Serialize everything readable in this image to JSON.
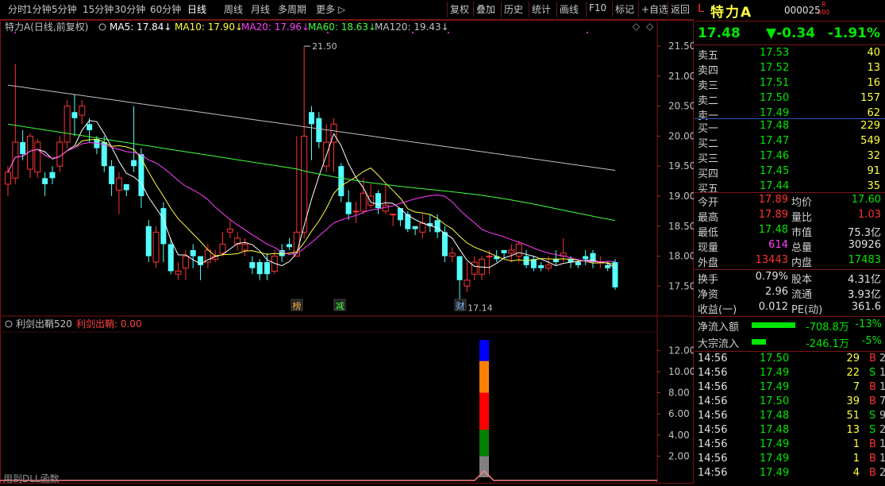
{
  "toolbar": {
    "left": [
      "分时",
      "1分钟",
      "5分钟",
      "15分钟",
      "30分钟",
      "60分钟",
      "日线",
      "周线",
      "月线",
      "多周期",
      "更多 ▷"
    ],
    "active_index": 6,
    "right": [
      "复权",
      "叠加",
      "历史",
      "统计",
      "画线",
      "F10",
      "标记",
      "+自选",
      "返回"
    ]
  },
  "chart_header": {
    "name": "特力A",
    "mode": "(日线,前复权)",
    "ma": [
      {
        "label": "MA5: 17.84↓",
        "color": "#ffffff"
      },
      {
        "label": "MA10: 17.90↓",
        "color": "#ffff40"
      },
      {
        "label": "MA20: 17.96↓",
        "color": "#ff40ff"
      },
      {
        "label": "MA60: 18.63↓",
        "color": "#40ff40"
      },
      {
        "label": "MA120: 19.43↓",
        "color": "#c0c0c0"
      }
    ]
  },
  "price_axis": [
    "21.50",
    "21.00",
    "20.50",
    "20.00",
    "19.50",
    "19.00",
    "18.50",
    "18.00",
    "17.50"
  ],
  "annotations": {
    "high": "21.50",
    "low": "17.14",
    "markers": [
      "榜",
      "减",
      "财"
    ]
  },
  "indicator": {
    "name": "利剑出鞘520",
    "value_label": "利剑出鞘: 0.00",
    "axis": [
      "12.00",
      "10.00",
      "8.00",
      "6.00",
      "4.00",
      "2.00"
    ],
    "footer": "用到DLL函数"
  },
  "chart_data": {
    "type": "candlestick",
    "ylim": [
      17.2,
      21.7
    ],
    "candles": [
      [
        19.2,
        19.4,
        19.0,
        19.5
      ],
      [
        19.3,
        19.9,
        19.2,
        21.2
      ],
      [
        19.9,
        19.7,
        19.6,
        20.1
      ],
      [
        19.45,
        20.0,
        19.3,
        20.05
      ],
      [
        19.4,
        19.9,
        19.3,
        19.95
      ],
      [
        19.3,
        19.2,
        19.0,
        19.4
      ],
      [
        19.4,
        19.3,
        19.2,
        19.5
      ],
      [
        19.5,
        19.9,
        19.4,
        20.0
      ],
      [
        19.9,
        20.5,
        19.8,
        20.6
      ],
      [
        20.4,
        20.3,
        20.0,
        20.7
      ],
      [
        20.35,
        20.5,
        20.2,
        20.6
      ],
      [
        20.2,
        20.1,
        19.9,
        20.3
      ],
      [
        19.95,
        19.8,
        19.7,
        20.0
      ],
      [
        19.9,
        19.5,
        19.4,
        20.0
      ],
      [
        19.5,
        19.2,
        19.0,
        19.6
      ],
      [
        19.1,
        19.3,
        18.7,
        19.4
      ],
      [
        19.2,
        19.1,
        19.0,
        19.2
      ],
      [
        19.6,
        19.5,
        19.4,
        20.5
      ],
      [
        19.7,
        19.0,
        18.8,
        19.8
      ],
      [
        18.5,
        18.0,
        17.9,
        18.6
      ],
      [
        17.9,
        18.4,
        17.8,
        18.5
      ],
      [
        18.8,
        18.2,
        17.9,
        18.9
      ],
      [
        18.2,
        17.75,
        17.7,
        18.3
      ],
      [
        17.7,
        17.75,
        17.6,
        17.9
      ],
      [
        17.8,
        18.0,
        17.6,
        18.1
      ],
      [
        18.1,
        18.0,
        17.8,
        18.2
      ],
      [
        18.0,
        17.85,
        17.6,
        17.95
      ],
      [
        17.9,
        18.1,
        17.8,
        18.2
      ],
      [
        17.95,
        18.0,
        17.9,
        18.1
      ],
      [
        18.05,
        18.2,
        18.0,
        18.4
      ],
      [
        18.4,
        18.45,
        18.3,
        18.6
      ],
      [
        18.2,
        18.3,
        18.1,
        18.4
      ],
      [
        18.1,
        18.2,
        18.0,
        18.3
      ],
      [
        17.9,
        17.8,
        17.7,
        18.0
      ],
      [
        17.9,
        17.7,
        17.6,
        17.95
      ],
      [
        17.9,
        17.7,
        17.6,
        18.05
      ],
      [
        17.75,
        18.0,
        17.7,
        18.1
      ],
      [
        18.1,
        18.0,
        17.9,
        18.2
      ],
      [
        18.2,
        18.15,
        18.1,
        18.3
      ],
      [
        18.0,
        18.4,
        18.0,
        20.0
      ],
      [
        18.4,
        20.0,
        18.3,
        21.5
      ],
      [
        20.4,
        20.2,
        19.6,
        20.5
      ],
      [
        20.3,
        19.9,
        19.8,
        20.4
      ],
      [
        19.5,
        19.9,
        19.4,
        20.2
      ],
      [
        19.9,
        20.2,
        19.4,
        20.3
      ],
      [
        19.5,
        19.0,
        18.9,
        19.55
      ],
      [
        18.9,
        18.7,
        18.6,
        19.1
      ],
      [
        18.75,
        18.75,
        18.55,
        18.9
      ],
      [
        18.75,
        19.05,
        18.7,
        19.3
      ],
      [
        18.85,
        19.0,
        18.8,
        19.2
      ],
      [
        19.05,
        18.8,
        18.7,
        19.1
      ],
      [
        18.75,
        18.85,
        18.7,
        19.2
      ],
      [
        18.7,
        18.7,
        18.5,
        18.7
      ],
      [
        18.8,
        18.6,
        18.5,
        18.8
      ],
      [
        18.7,
        18.45,
        18.4,
        18.75
      ],
      [
        18.5,
        18.45,
        18.35,
        18.5
      ],
      [
        18.4,
        18.55,
        18.3,
        18.7
      ],
      [
        18.55,
        18.5,
        18.4,
        18.7
      ],
      [
        18.6,
        18.4,
        18.3,
        18.7
      ],
      [
        18.4,
        18.0,
        17.9,
        18.5
      ],
      [
        18.0,
        18.05,
        17.9,
        18.15
      ],
      [
        18.0,
        17.6,
        17.14,
        18.0
      ],
      [
        17.5,
        17.6,
        17.4,
        17.9
      ],
      [
        17.7,
        17.9,
        17.6,
        18.0
      ],
      [
        17.7,
        17.95,
        17.6,
        18.0
      ],
      [
        18.0,
        18.0,
        17.7,
        18.1
      ],
      [
        18.0,
        17.95,
        17.9,
        18.1
      ],
      [
        18.1,
        18.05,
        17.95,
        18.1
      ],
      [
        18.05,
        18.1,
        17.9,
        18.2
      ],
      [
        18.0,
        18.2,
        17.9,
        18.25
      ],
      [
        18.0,
        17.85,
        17.8,
        18.1
      ],
      [
        17.95,
        17.8,
        17.75,
        18.0
      ],
      [
        17.85,
        17.8,
        17.75,
        17.9
      ],
      [
        17.8,
        17.85,
        17.75,
        18.0
      ],
      [
        17.95,
        17.9,
        17.85,
        18.1
      ],
      [
        18.0,
        18.05,
        17.9,
        18.3
      ],
      [
        17.95,
        17.9,
        17.8,
        18.0
      ],
      [
        17.9,
        17.85,
        17.8,
        17.95
      ],
      [
        18.0,
        17.95,
        17.85,
        18.1
      ],
      [
        18.05,
        17.9,
        17.8,
        18.1
      ],
      [
        17.9,
        17.9,
        17.8,
        18.0
      ],
      [
        17.85,
        17.8,
        17.75,
        17.9
      ],
      [
        17.9,
        17.48,
        17.44,
        17.95
      ]
    ]
  },
  "quote": {
    "prefix": "L",
    "name": "特力A",
    "code": "000025",
    "code_badge_top": "R",
    "code_badge_bottom": "500",
    "price": "17.48",
    "change": "▼-0.34",
    "change_pct": "-1.91%",
    "asks": [
      {
        "label": "卖五",
        "price": "17.53",
        "vol": "40"
      },
      {
        "label": "卖四",
        "price": "17.52",
        "vol": "13"
      },
      {
        "label": "卖三",
        "price": "17.51",
        "vol": "16"
      },
      {
        "label": "卖二",
        "price": "17.50",
        "vol": "157"
      },
      {
        "label": "卖一",
        "price": "17.49",
        "vol": "62"
      }
    ],
    "bids": [
      {
        "label": "买一",
        "price": "17.48",
        "vol": "229"
      },
      {
        "label": "买二",
        "price": "17.47",
        "vol": "549"
      },
      {
        "label": "买三",
        "price": "17.46",
        "vol": "32"
      },
      {
        "label": "买四",
        "price": "17.45",
        "vol": "91"
      },
      {
        "label": "买五",
        "price": "17.44",
        "vol": "35"
      }
    ],
    "stats": [
      {
        "l1": "今开",
        "v1": "17.89",
        "c1": "#ff3232",
        "l2": "均价",
        "v2": "17.60",
        "c2": "#00e600"
      },
      {
        "l1": "最高",
        "v1": "17.89",
        "c1": "#ff3232",
        "l2": "量比",
        "v2": "1.03",
        "c2": "#ff3232"
      },
      {
        "l1": "最低",
        "v1": "17.48",
        "c1": "#00e600",
        "l2": "市值",
        "v2": "75.3亿",
        "c2": "#e0e0e0"
      },
      {
        "l1": "现量",
        "v1": "614",
        "c1": "#ff40ff",
        "l2": "总量",
        "v2": "30926",
        "c2": "#e0e0e0"
      },
      {
        "l1": "外盘",
        "v1": "13443",
        "c1": "#ff3232",
        "l2": "内盘",
        "v2": "17483",
        "c2": "#00e600"
      }
    ],
    "stats2": [
      {
        "l1": "换手",
        "v1": "0.79%",
        "l2": "股本",
        "v2": "4.31亿"
      },
      {
        "l1": "净资",
        "v1": "2.96",
        "l2": "流通",
        "v2": "3.93亿"
      },
      {
        "l1": "收益(一)",
        "v1": "0.012",
        "l2": "PE(动)",
        "v2": "361.6"
      }
    ],
    "flows": [
      {
        "label": "净流入额",
        "value": "-708.8万",
        "pct": "-13%",
        "fill": 0.55
      },
      {
        "label": "大宗流入",
        "value": "-246.1万",
        "pct": "-5%",
        "fill": 0.18
      }
    ],
    "trades": [
      {
        "time": "14:56",
        "price": "17.50",
        "vol": "29",
        "side": "B",
        "n": "2"
      },
      {
        "time": "14:56",
        "price": "17.49",
        "vol": "22",
        "side": "S",
        "n": "1"
      },
      {
        "time": "14:56",
        "price": "17.49",
        "vol": "7",
        "side": "B",
        "n": "1"
      },
      {
        "time": "14:56",
        "price": "17.50",
        "vol": "39",
        "side": "B",
        "n": "7"
      },
      {
        "time": "14:56",
        "price": "17.48",
        "vol": "51",
        "side": "S",
        "n": "9"
      },
      {
        "time": "14:56",
        "price": "17.48",
        "vol": "13",
        "side": "S",
        "n": "2"
      },
      {
        "time": "14:56",
        "price": "17.49",
        "vol": "1",
        "side": "B",
        "n": "1"
      },
      {
        "time": "14:56",
        "price": "17.49",
        "vol": "1",
        "side": "B",
        "n": "1"
      },
      {
        "time": "14:56",
        "price": "17.49",
        "vol": "4",
        "side": "B",
        "n": "2"
      }
    ]
  }
}
